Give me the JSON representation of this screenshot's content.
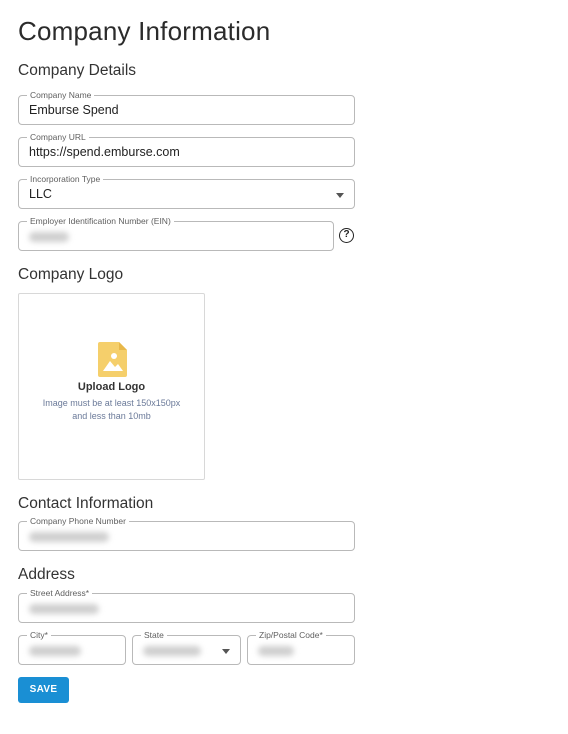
{
  "page": {
    "title": "Company Information"
  },
  "company_details": {
    "heading": "Company Details",
    "company_name": {
      "label": "Company Name",
      "value": "Emburse Spend"
    },
    "company_url": {
      "label": "Company URL",
      "value": "https://spend.emburse.com"
    },
    "incorporation_type": {
      "label": "Incorporation Type",
      "value": "LLC"
    },
    "ein": {
      "label": "Employer Identification Number (EIN)",
      "help_icon": "?"
    }
  },
  "company_logo": {
    "heading": "Company Logo",
    "upload_title": "Upload Logo",
    "upload_hint": "Image must be at least 150x150px\nand less than 10mb"
  },
  "contact_information": {
    "heading": "Contact Information",
    "phone": {
      "label": "Company Phone Number"
    }
  },
  "address": {
    "heading": "Address",
    "street": {
      "label": "Street Address*"
    },
    "city": {
      "label": "City*"
    },
    "state": {
      "label": "State"
    },
    "zip": {
      "label": "Zip/Postal Code*"
    }
  },
  "actions": {
    "save_label": "SAVE"
  },
  "colors": {
    "accent": "#1a8fd4",
    "file_icon": "#f5cf6b"
  }
}
